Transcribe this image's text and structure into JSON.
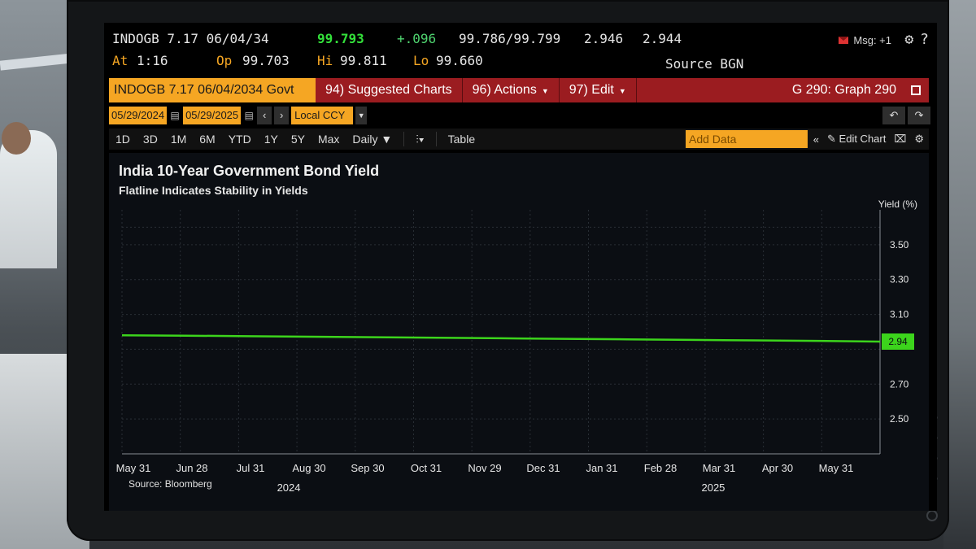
{
  "quote": {
    "ticker": "INDOGB 7.17 06/04/34",
    "last_price": "99.793",
    "change": "+.096",
    "bid_ask": "99.786/99.799",
    "yield1": "2.946",
    "yield2": "2.944",
    "at_label": "At",
    "at_time": "1:16",
    "op_label": "Op",
    "op_value": "99.703",
    "hi_label": "Hi",
    "hi_value": "99.811",
    "lo_label": "Lo",
    "lo_value": "99.660",
    "source": "Source BGN",
    "msg": "Msg: +1",
    "settings_icon": "gear-icon",
    "help": "?"
  },
  "function_bar": {
    "security": "INDOGB 7.17 06/04/2034 Govt",
    "suggested": "94) Suggested Charts",
    "actions": "96) Actions",
    "edit": "97) Edit",
    "graph": "G 290: Graph 290"
  },
  "dates": {
    "start": "05/29/2024",
    "end": "05/29/2025",
    "currency": "Local CCY"
  },
  "ranges": {
    "items": [
      "1D",
      "3D",
      "1M",
      "6M",
      "YTD",
      "1Y",
      "5Y",
      "Max"
    ],
    "frequency": "Daily ▼",
    "table": "Table",
    "add_data_placeholder": "Add Data",
    "edit_chart": "Edit Chart"
  },
  "chart_data": {
    "type": "line",
    "title": "India 10-Year Government Bond Yield",
    "subtitle": "Flatline Indicates Stability in Yields",
    "ylabel": "Yield (%)",
    "xlabel": "",
    "ylim": [
      2.3,
      3.7
    ],
    "y_ticks": [
      "3.50",
      "3.30",
      "3.10",
      "2.70",
      "2.50"
    ],
    "x_ticks": [
      "May 31",
      "Jun 28",
      "Jul 31",
      "Aug 30",
      "Sep 30",
      "Oct 31",
      "Nov 29",
      "Dec 31",
      "Jan 31",
      "Feb 28",
      "Mar 31",
      "Apr 30",
      "May 31"
    ],
    "years": [
      "2024",
      "2025"
    ],
    "x": [
      "2024-05-29",
      "2024-06-28",
      "2024-07-31",
      "2024-08-30",
      "2024-09-30",
      "2024-10-31",
      "2024-11-29",
      "2024-12-31",
      "2025-01-31",
      "2025-02-28",
      "2025-03-31",
      "2025-04-30",
      "2025-05-29"
    ],
    "series": [
      {
        "values": [
          2.98,
          2.978,
          2.975,
          2.972,
          2.969,
          2.966,
          2.963,
          2.96,
          2.957,
          2.954,
          2.951,
          2.948,
          2.944
        ]
      }
    ],
    "last_value_label": "2.94",
    "line_color": "#3cd41c",
    "grid": true,
    "source": "Source: Bloomberg"
  }
}
